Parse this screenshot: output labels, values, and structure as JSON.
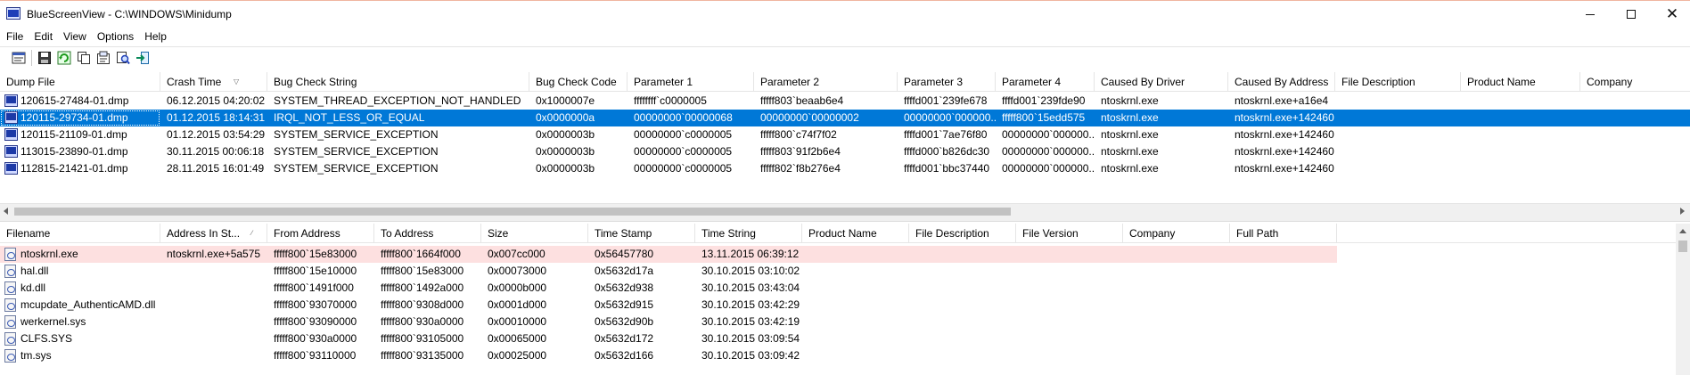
{
  "window": {
    "title": "BlueScreenView  -  C:\\WINDOWS\\Minidump",
    "min_glyph": "",
    "close_glyph": "✕"
  },
  "menu": [
    "File",
    "Edit",
    "View",
    "Options",
    "Help"
  ],
  "toolbar": {
    "icons": [
      "properties-icon",
      "save-icon",
      "refresh-icon",
      "copy-icon",
      "html-report-icon",
      "find-icon",
      "exit-icon"
    ]
  },
  "dumps": {
    "columns": [
      "Dump File",
      "Crash Time",
      "Bug Check String",
      "Bug Check Code",
      "Parameter 1",
      "Parameter 2",
      "Parameter 3",
      "Parameter 4",
      "Caused By Driver",
      "Caused By Address",
      "File Description",
      "Product Name",
      "Company"
    ],
    "sort_glyph": "▽",
    "rows": [
      [
        "120615-27484-01.dmp",
        "06.12.2015 04:20:02",
        "SYSTEM_THREAD_EXCEPTION_NOT_HANDLED",
        "0x1000007e",
        "ffffffff`c0000005",
        "fffff803`beaab6e4",
        "ffffd001`239fe678",
        "ffffd001`239fde90",
        "ntoskrnl.exe",
        "ntoskrnl.exe+a16e4",
        "",
        "",
        ""
      ],
      [
        "120115-29734-01.dmp",
        "01.12.2015 18:14:31",
        "IRQL_NOT_LESS_OR_EQUAL",
        "0x0000000a",
        "00000000`00000068",
        "00000000`00000002",
        "00000000`000000...",
        "fffff800`15edd575",
        "ntoskrnl.exe",
        "ntoskrnl.exe+142460",
        "",
        "",
        ""
      ],
      [
        "120115-21109-01.dmp",
        "01.12.2015 03:54:29",
        "SYSTEM_SERVICE_EXCEPTION",
        "0x0000003b",
        "00000000`c0000005",
        "fffff800`c74f7f02",
        "ffffd001`7ae76f80",
        "00000000`000000...",
        "ntoskrnl.exe",
        "ntoskrnl.exe+142460",
        "",
        "",
        ""
      ],
      [
        "113015-23890-01.dmp",
        "30.11.2015 00:06:18",
        "SYSTEM_SERVICE_EXCEPTION",
        "0x0000003b",
        "00000000`c0000005",
        "fffff803`91f2b6e4",
        "ffffd000`b826dc30",
        "00000000`000000...",
        "ntoskrnl.exe",
        "ntoskrnl.exe+142460",
        "",
        "",
        ""
      ],
      [
        "112815-21421-01.dmp",
        "28.11.2015 16:01:49",
        "SYSTEM_SERVICE_EXCEPTION",
        "0x0000003b",
        "00000000`c0000005",
        "fffff802`f8b276e4",
        "ffffd001`bbc37440",
        "00000000`000000...",
        "ntoskrnl.exe",
        "ntoskrnl.exe+142460",
        "",
        "",
        ""
      ]
    ],
    "selected_row": 1
  },
  "drivers": {
    "columns": [
      "Filename",
      "Address In St...",
      "From Address",
      "To Address",
      "Size",
      "Time Stamp",
      "Time String",
      "Product Name",
      "File Description",
      "File Version",
      "Company",
      "Full Path"
    ],
    "sort_glyph": "∕",
    "rows": [
      [
        "ntoskrnl.exe",
        "ntoskrnl.exe+5a575",
        "fffff800`15e83000",
        "fffff800`1664f000",
        "0x007cc000",
        "0x56457780",
        "13.11.2015 06:39:12",
        "",
        "",
        "",
        "",
        ""
      ],
      [
        "hal.dll",
        "",
        "fffff800`15e10000",
        "fffff800`15e83000",
        "0x00073000",
        "0x5632d17a",
        "30.10.2015 03:10:02",
        "",
        "",
        "",
        "",
        ""
      ],
      [
        "kd.dll",
        "",
        "fffff800`1491f000",
        "fffff800`1492a000",
        "0x0000b000",
        "0x5632d938",
        "30.10.2015 03:43:04",
        "",
        "",
        "",
        "",
        ""
      ],
      [
        "mcupdate_AuthenticAMD.dll",
        "",
        "fffff800`93070000",
        "fffff800`9308d000",
        "0x0001d000",
        "0x5632d915",
        "30.10.2015 03:42:29",
        "",
        "",
        "",
        "",
        ""
      ],
      [
        "werkernel.sys",
        "",
        "fffff800`93090000",
        "fffff800`930a0000",
        "0x00010000",
        "0x5632d90b",
        "30.10.2015 03:42:19",
        "",
        "",
        "",
        "",
        ""
      ],
      [
        "CLFS.SYS",
        "",
        "fffff800`930a0000",
        "fffff800`93105000",
        "0x00065000",
        "0x5632d172",
        "30.10.2015 03:09:54",
        "",
        "",
        "",
        "",
        ""
      ],
      [
        "tm.sys",
        "",
        "fffff800`93110000",
        "fffff800`93135000",
        "0x00025000",
        "0x5632d166",
        "30.10.2015 03:09:42",
        "",
        "",
        "",
        "",
        ""
      ]
    ],
    "highlighted_row": 0
  }
}
